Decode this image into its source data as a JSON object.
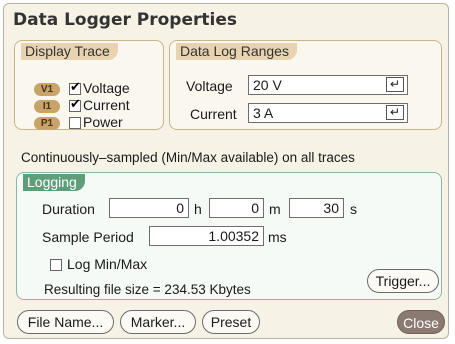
{
  "window": {
    "title": "Data Logger Properties"
  },
  "display_trace": {
    "label": "Display Trace",
    "items": [
      {
        "badge": "V1",
        "label": "Voltage",
        "checked": true
      },
      {
        "badge": "I1",
        "label": "Current",
        "checked": true
      },
      {
        "badge": "P1",
        "label": "Power",
        "checked": false
      }
    ]
  },
  "ranges": {
    "label": "Data Log Ranges",
    "voltage_label": "Voltage",
    "voltage_value": "20 V",
    "current_label": "Current",
    "current_value": "3 A",
    "enter_glyph": "↵"
  },
  "info": {
    "text": "Continuously–sampled (Min/Max available)  on all traces"
  },
  "logging": {
    "label": "Logging",
    "duration_label": "Duration",
    "hours": "0",
    "hours_unit": "h",
    "minutes": "0",
    "minutes_unit": "m",
    "seconds": "30",
    "seconds_unit": "s",
    "sample_period_label": "Sample Period",
    "sample_period": "1.00352",
    "sample_period_unit": "ms",
    "log_minmax_label": "Log Min/Max",
    "log_minmax_checked": false,
    "file_size": "Resulting file size = 234.53 Kbytes",
    "trigger_button": "Trigger..."
  },
  "buttons": {
    "file_name": "File Name...",
    "marker": "Marker...",
    "preset": "Preset",
    "close": "Close"
  },
  "colors": {
    "group_tan": "#e7d3b0",
    "group_green": "#5f9e7a",
    "close_bg": "#8a7a72",
    "badge": "#c8a36a"
  },
  "icons": [
    "check-icon",
    "enter-arrow-icon"
  ]
}
